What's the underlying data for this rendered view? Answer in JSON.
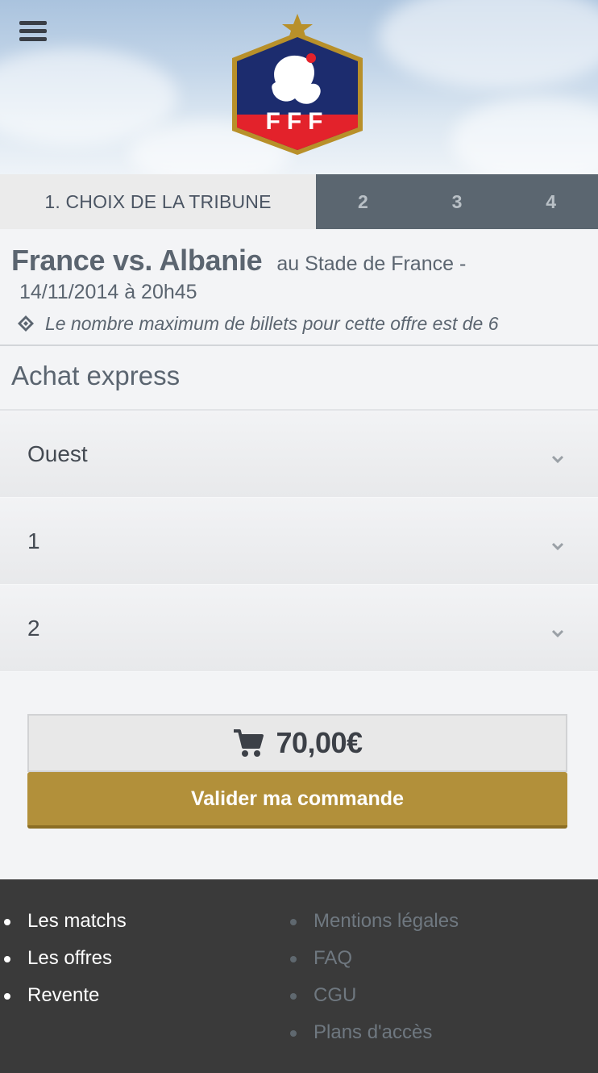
{
  "header": {
    "menu_icon": "hamburger-menu-icon",
    "logo_text": "FFF",
    "colors": {
      "shield_blue": "#1c2c6e",
      "shield_red": "#e3222b",
      "shield_gold": "#b8902a"
    }
  },
  "steps": {
    "active_label": "1. CHOIX DE LA TRIBUNE",
    "others": [
      "2",
      "3",
      "4"
    ]
  },
  "match": {
    "title": "France vs. Albanie",
    "venue": "au Stade de France -",
    "datetime": "14/11/2014 à 20h45",
    "max_tickets_note": "Le nombre maximum de billets pour cette offre est de 6"
  },
  "express": {
    "title": "Achat express",
    "selects": [
      {
        "value": "Ouest"
      },
      {
        "value": "1"
      },
      {
        "value": "2"
      }
    ]
  },
  "order": {
    "total": "70,00€",
    "validate_label": "Valider ma commande",
    "accent_color": "#b2903a"
  },
  "footer": {
    "primary_links": [
      "Les matchs",
      "Les offres",
      "Revente"
    ],
    "secondary_links": [
      "Mentions légales",
      "FAQ",
      "CGU",
      "Plans d'accès"
    ]
  }
}
